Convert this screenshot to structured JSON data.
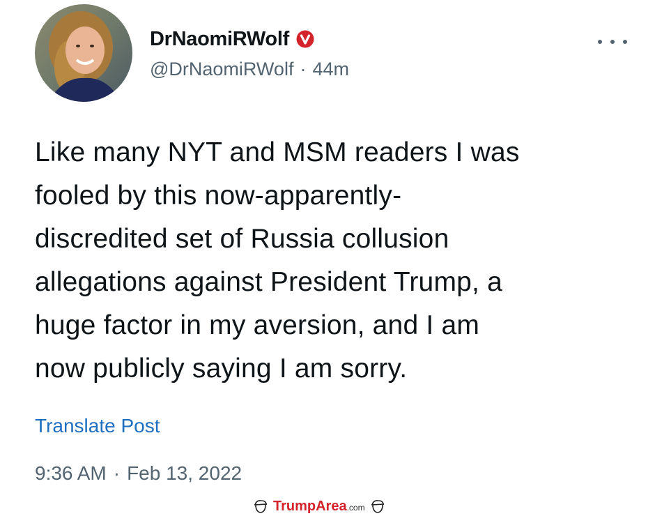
{
  "author": {
    "display_name": "DrNaomiRWolf",
    "handle": "@DrNaomiRWolf",
    "time_ago": "44m",
    "separator": "·",
    "verified_badge_icon": "verified-badge-icon",
    "verified_badge_color": "#d4232a"
  },
  "post": {
    "lines": [
      "Like many NYT and MSM readers I was",
      "fooled by this now-apparently-",
      "discredited set of Russia collusion",
      "allegations against President Trump, a",
      "huge factor in my aversion, and I am",
      "now publicly saying I am sorry."
    ]
  },
  "actions": {
    "more_icon": "more-horizontal-icon",
    "translate_label": "Translate Post"
  },
  "meta": {
    "time": "9:36 AM",
    "separator": "·",
    "date": "Feb 13, 2022"
  },
  "watermark": {
    "brand": "TrumpArea",
    "suffix": ".com"
  },
  "colors": {
    "text_primary": "#0f1419",
    "text_secondary": "#536471",
    "link": "#1d6fbf",
    "badge": "#d4232a"
  }
}
